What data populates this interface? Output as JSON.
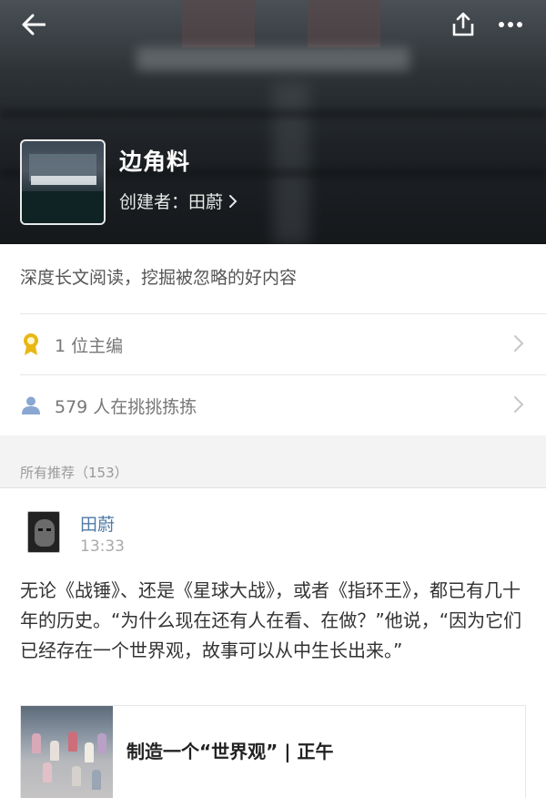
{
  "header": {
    "title": "边角料",
    "creator_label": "创建者：田蔚",
    "back_icon": "arrow-left-icon",
    "share_icon": "share-upload-icon",
    "more_icon": "more-dots-icon"
  },
  "description": "深度长文阅读，挖掘被忽略的好内容",
  "rows": [
    {
      "icon": "award-ribbon-icon",
      "label": "1 位主编"
    },
    {
      "icon": "person-icon",
      "label": "579 人在挑挑拣拣"
    }
  ],
  "section_label": "所有推荐（153）",
  "post": {
    "author": "田蔚",
    "time": "13:33",
    "text": "无论《战锤》、还是《星球大战》，或者《指环王》，都已有几十年的历史。“为什么现在还有人在看、在做？”他说，“因为它们已经存在一个世界观，故事可以从中生长出来。”",
    "link_title": "制造一个“世界观” | 正午"
  },
  "colors": {
    "author_link": "#4f79a6",
    "award_icon": "#e8b714",
    "person_icon": "#8aa7d1"
  }
}
